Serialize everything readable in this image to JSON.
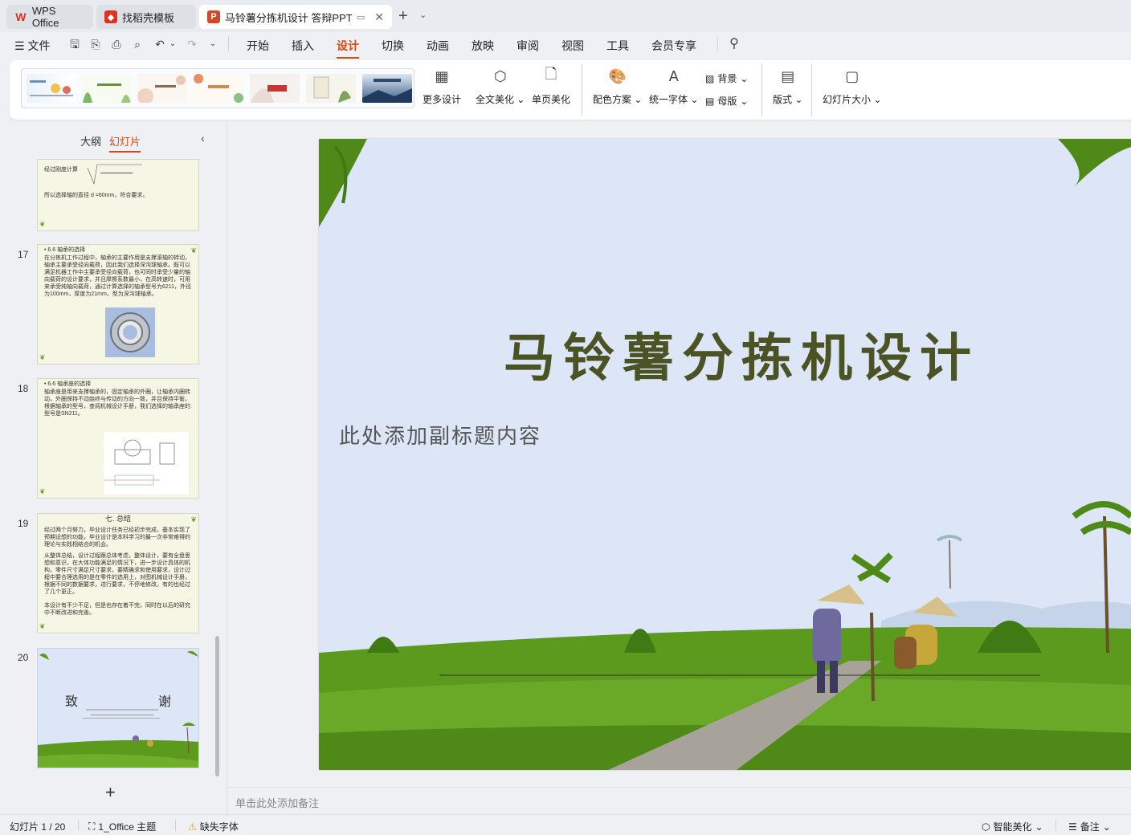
{
  "tabs": [
    {
      "label": "WPS Office"
    },
    {
      "label": "找稻壳模板"
    },
    {
      "label": "马铃薯分拣机设计 答辩PPT.pp"
    }
  ],
  "menu": {
    "file": "文件",
    "items": [
      "开始",
      "插入",
      "设计",
      "切换",
      "动画",
      "放映",
      "审阅",
      "视图",
      "工具",
      "会员专享"
    ],
    "active": "设计"
  },
  "ribbon": {
    "more_design": "更多设计",
    "full_beautify": "全文美化",
    "page_beautify": "单页美化",
    "color_scheme": "配色方案",
    "unify_font": "统一字体",
    "background": "背景",
    "master": "母版",
    "layout": "版式",
    "slide_size": "幻灯片大小"
  },
  "leftpanel": {
    "tab_outline": "大纲",
    "tab_slides": "幻灯片",
    "slides": [
      {
        "num": "",
        "lines": [
          "经过刚度计算",
          "所以选择轴的直径 d    =60mm，符合要求。"
        ]
      },
      {
        "num": "17",
        "lines": [
          "• 6.6  轴承的选择",
          "在分拣机工作过程中，轴承的主要作用是支撑滚轴的转动，轴承主要承受径向载荷，因此我们选择深沟球轴承。既可以满足机器工作中主要承受径向载荷，也可同时承受少量的轴向载荷的设计要求，并且摩擦系数最小，在高转速时，可用来承受纯轴向载荷，通过计算选择的轴承型号为6211，外径为100mm，厚度为21mm，型为深沟球轴承。"
        ]
      },
      {
        "num": "18",
        "lines": [
          "• 6.6  轴承座的选择",
          "轴承座是用来支撑轴承的，固定轴承的外圈，让轴承内圈转动，外圈保持不动始终与传动的方向一致，并且保持平衡，根据轴承的型号，查阅机械设计手册，我们选择的轴承座的型号是SN211。"
        ]
      },
      {
        "num": "19",
        "lines": [
          "七. 总结",
          "经过两个月努力，毕业设计任务已经初步完成，基本实现了预期设想的功能，毕业设计是本科学习的最一次非常难得的理论与实践相结合的机会。",
          "从整体总结，设计过程跟总体考虑，整体设计，要有全盘思想和意识，在大体功能满足的情况下，进一步设计具体的机构，零件尺寸满足尺寸要求，要精确求和使用要求，设计过程中要合理选用的是在零件的选用上，对图机械设计手册，根据不同的数据要求，进行要求，不停地修改，有的也经过了几个更正。",
          "本设计有不少不足，但是也存在着不完，同时在以后的研究中不断改进和完善。"
        ]
      },
      {
        "num": "20",
        "lines": [
          "致",
          "谢"
        ]
      }
    ],
    "add_slide": "+"
  },
  "slide": {
    "title": "马铃薯分拣机设计",
    "subtitle": "此处添加副标题内容"
  },
  "notes_placeholder": "单击此处添加备注",
  "status": {
    "slide_counter": "幻灯片 1 / 20",
    "theme": "1_Office 主题",
    "missing_font": "缺失字体",
    "smart_beautify": "智能美化",
    "notes": "备注"
  },
  "colors": {
    "accent": "#d9480f",
    "title_text": "#4b5224",
    "slide_bg": "#dde6f7",
    "field_green": "#5c9a1e"
  }
}
